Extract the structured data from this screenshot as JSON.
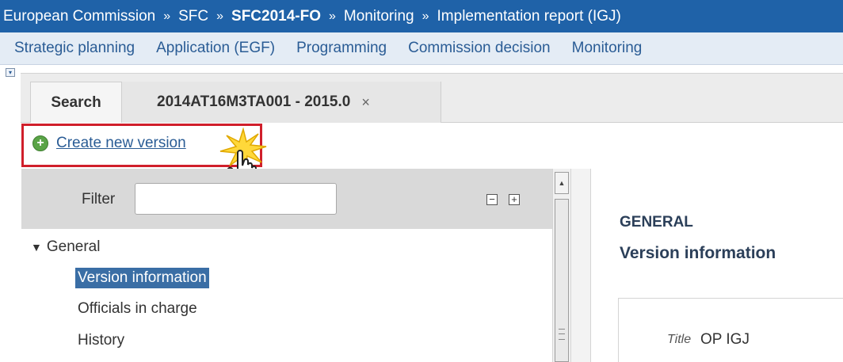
{
  "breadcrumb": {
    "items": [
      "European Commission",
      "SFC",
      "SFC2014-FO",
      "Monitoring",
      "Implementation report (IGJ)"
    ],
    "separator": "»"
  },
  "menu": {
    "items": [
      "Strategic planning",
      "Application (EGF)",
      "Programming",
      "Commission decision",
      "Monitoring"
    ]
  },
  "tabs": {
    "search_label": "Search",
    "record_label": "2014AT16M3TA001 - 2015.0",
    "close_symbol": "×"
  },
  "actions": {
    "create_new_version": "Create new version"
  },
  "tree": {
    "filter_label": "Filter",
    "filter_value": "",
    "collapse_all": "−",
    "expand_all": "+",
    "group_label": "General",
    "group_caret": "▼",
    "items": [
      "Version information",
      "Officials in charge",
      "History"
    ],
    "selected_item": "Version information"
  },
  "content": {
    "section_title": "GENERAL",
    "section_subtitle": "Version information",
    "title_field_label": "Title",
    "title_field_value": "OP IGJ"
  },
  "colors": {
    "header_blue": "#1f62a8",
    "link_blue": "#2a5c95",
    "highlight_red": "#d01f2b",
    "selected_bg": "#3a6ea5"
  }
}
